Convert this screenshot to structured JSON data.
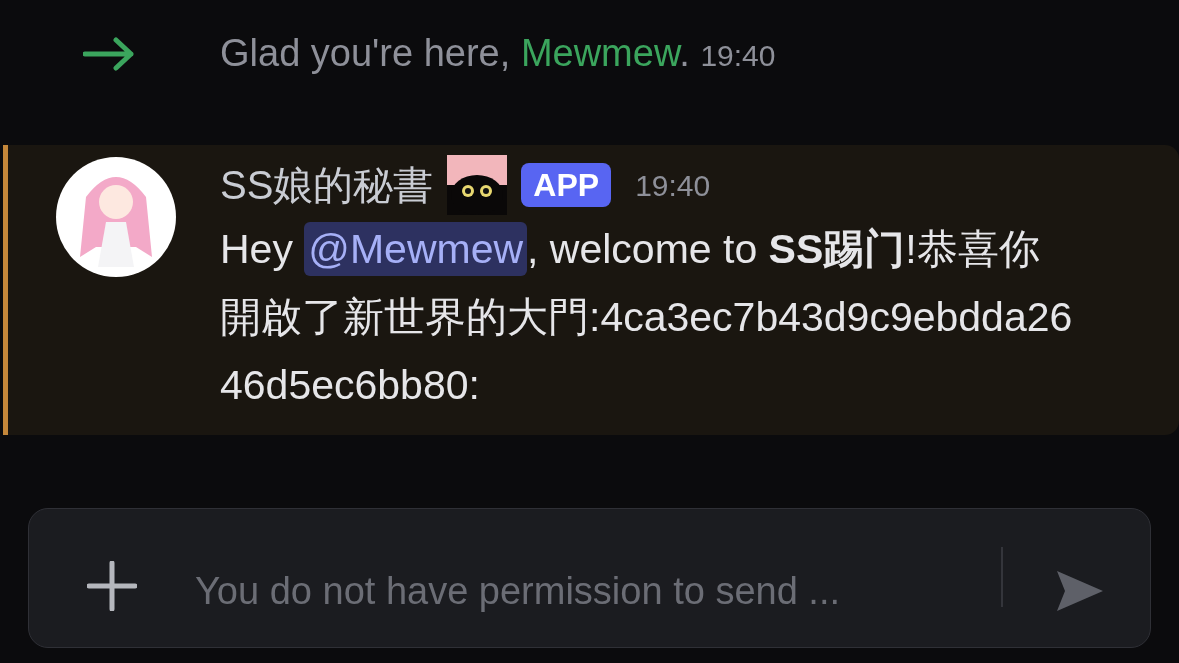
{
  "system_message": {
    "text": "Glad you're here, ",
    "user": "Mewmew",
    "end": ".",
    "time": "19:40"
  },
  "message": {
    "highlighted": true,
    "author": "SS娘的秘書",
    "badge": "APP",
    "time": "19:40",
    "greeting": "Hey ",
    "mention": "@Mewmew",
    "body": ", welcome to **SS踢门**!恭喜你開啟了新世界的大門:4ca3ec7b43d9c9ebdda2646d5ec6bb80:"
  },
  "composer": {
    "placeholder": "You do not have permission to send ..."
  }
}
